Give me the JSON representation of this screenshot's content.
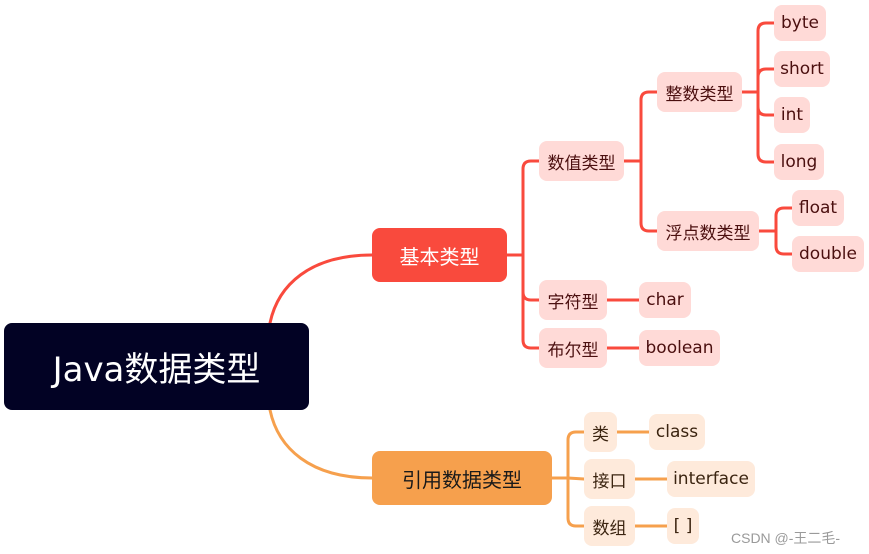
{
  "colors": {
    "root_bg": "#020224",
    "primitive_branch": "#f94a3d",
    "reference_branch": "#f6a04d",
    "primitive_leaf_bg": "#ffdad7",
    "reference_leaf_bg": "#feeadb"
  },
  "root": {
    "label": "Java数据类型"
  },
  "primitive": {
    "label": "基本类型",
    "numeric": {
      "label": "数值类型",
      "integer": {
        "label": "整数类型",
        "items": [
          "byte",
          "short",
          "int",
          "long"
        ]
      },
      "floating": {
        "label": "浮点数类型",
        "items": [
          "float",
          "double"
        ]
      }
    },
    "character": {
      "label": "字符型",
      "items": [
        "char"
      ]
    },
    "boolean": {
      "label": "布尔型",
      "items": [
        "boolean"
      ]
    }
  },
  "reference": {
    "label": "引用数据类型",
    "class": {
      "label": "类",
      "items": [
        "class"
      ]
    },
    "interface": {
      "label": "接口",
      "items": [
        "interface"
      ]
    },
    "array": {
      "label": "数组",
      "items": [
        "[ ]"
      ]
    }
  },
  "watermark": "CSDN @-王二毛-"
}
